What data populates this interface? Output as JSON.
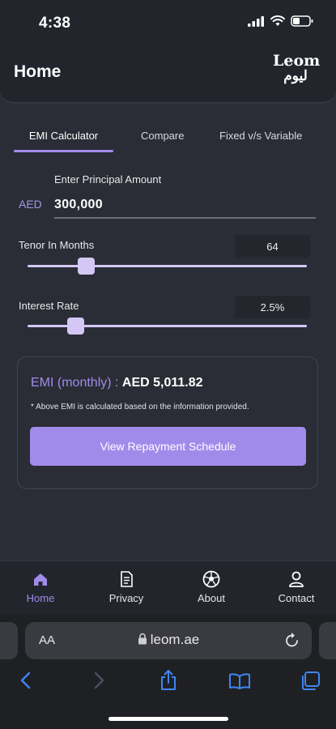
{
  "status": {
    "time": "4:38"
  },
  "header": {
    "title": "Home",
    "logo_top": "Leom",
    "logo_bottom": "ليوم"
  },
  "tabs": [
    {
      "label": "EMI Calculator",
      "active": true
    },
    {
      "label": "Compare",
      "active": false
    },
    {
      "label": "Fixed v/s Variable",
      "active": false
    }
  ],
  "principal": {
    "label": "Enter Principal Amount",
    "currency": "AED",
    "value": "300,000"
  },
  "tenor": {
    "label": "Tenor In Months",
    "value": "64",
    "slider_fraction": 0.21
  },
  "interest": {
    "label": "Interest Rate",
    "value": "2.5%",
    "slider_fraction": 0.17
  },
  "emi": {
    "label": "EMI (monthly) :",
    "value": "AED 5,011.82",
    "note": "* Above EMI is calculated based on the information provided.",
    "button_label": "View Repayment Schedule"
  },
  "bottom_nav": [
    {
      "label": "Home",
      "icon": "home-icon",
      "active": true
    },
    {
      "label": "Privacy",
      "icon": "document-icon",
      "active": false
    },
    {
      "label": "About",
      "icon": "soccer-ball-icon",
      "active": false
    },
    {
      "label": "Contact",
      "icon": "person-icon",
      "active": false
    }
  ],
  "browser": {
    "aa_label": "AA",
    "url": "leom.ae"
  },
  "colors": {
    "accent": "#a18bea",
    "background": "#2a2d35",
    "header": "#22252c",
    "slider": "#d3c8f3"
  }
}
